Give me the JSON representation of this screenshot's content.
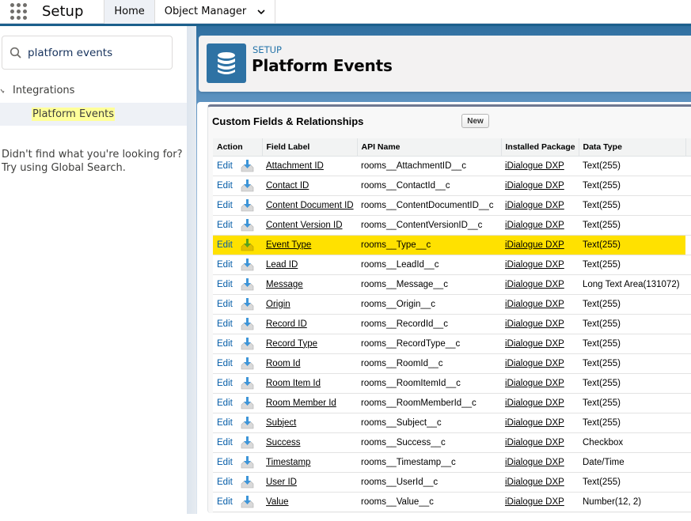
{
  "topbar": {
    "app_launcher_icon": "app-launcher-grid-icon",
    "app_title": "Setup",
    "tabs": [
      {
        "label": "Home",
        "active": true
      },
      {
        "label": "Object Manager",
        "active": false,
        "has_dropdown": true
      }
    ]
  },
  "sidebar": {
    "search": {
      "value": "platform events",
      "icon": "search-icon"
    },
    "tree": {
      "group_label": "Integrations",
      "group_expanded": true,
      "items": [
        {
          "label": "Platform Events",
          "selected": true,
          "highlighted_match": true
        }
      ]
    },
    "help_line1": "Didn't find what you're looking for?",
    "help_line2": "Try using Global Search."
  },
  "header": {
    "icon": "database-icon",
    "eyebrow": "SETUP",
    "title": "Platform Events"
  },
  "related_list": {
    "title": "Custom Fields & Relationships",
    "new_button": "New",
    "columns": [
      "Action",
      "Field Label",
      "API Name",
      "Installed Package",
      "Data Type"
    ],
    "highlight_color": "#ffe100",
    "rows": [
      {
        "action": "Edit",
        "label": "Attachment ID",
        "api": "rooms__AttachmentID__c",
        "package": "iDialogue DXP",
        "type": "Text(255)",
        "highlighted": false
      },
      {
        "action": "Edit",
        "label": "Contact ID",
        "api": "rooms__ContactId__c",
        "package": "iDialogue DXP",
        "type": "Text(255)",
        "highlighted": false
      },
      {
        "action": "Edit",
        "label": "Content Document ID",
        "api": "rooms__ContentDocumentID__c",
        "package": "iDialogue DXP",
        "type": "Text(255)",
        "highlighted": false
      },
      {
        "action": "Edit",
        "label": "Content Version ID",
        "api": "rooms__ContentVersionID__c",
        "package": "iDialogue DXP",
        "type": "Text(255)",
        "highlighted": false
      },
      {
        "action": "Edit",
        "label": "Event Type",
        "api": "rooms__Type__c",
        "package": "iDialogue DXP",
        "type": "Text(255)",
        "highlighted": true
      },
      {
        "action": "Edit",
        "label": "Lead ID",
        "api": "rooms__LeadId__c",
        "package": "iDialogue DXP",
        "type": "Text(255)",
        "highlighted": false
      },
      {
        "action": "Edit",
        "label": "Message",
        "api": "rooms__Message__c",
        "package": "iDialogue DXP",
        "type": "Long Text Area(131072)",
        "highlighted": false
      },
      {
        "action": "Edit",
        "label": "Origin",
        "api": "rooms__Origin__c",
        "package": "iDialogue DXP",
        "type": "Text(255)",
        "highlighted": false
      },
      {
        "action": "Edit",
        "label": "Record ID",
        "api": "rooms__RecordId__c",
        "package": "iDialogue DXP",
        "type": "Text(255)",
        "highlighted": false
      },
      {
        "action": "Edit",
        "label": "Record Type",
        "api": "rooms__RecordType__c",
        "package": "iDialogue DXP",
        "type": "Text(255)",
        "highlighted": false
      },
      {
        "action": "Edit",
        "label": "Room Id",
        "api": "rooms__RoomId__c",
        "package": "iDialogue DXP",
        "type": "Text(255)",
        "highlighted": false
      },
      {
        "action": "Edit",
        "label": "Room Item Id",
        "api": "rooms__RoomItemId__c",
        "package": "iDialogue DXP",
        "type": "Text(255)",
        "highlighted": false
      },
      {
        "action": "Edit",
        "label": "Room Member Id",
        "api": "rooms__RoomMemberId__c",
        "package": "iDialogue DXP",
        "type": "Text(255)",
        "highlighted": false
      },
      {
        "action": "Edit",
        "label": "Subject",
        "api": "rooms__Subject__c",
        "package": "iDialogue DXP",
        "type": "Text(255)",
        "highlighted": false
      },
      {
        "action": "Edit",
        "label": "Success",
        "api": "rooms__Success__c",
        "package": "iDialogue DXP",
        "type": "Checkbox",
        "highlighted": false
      },
      {
        "action": "Edit",
        "label": "Timestamp",
        "api": "rooms__Timestamp__c",
        "package": "iDialogue DXP",
        "type": "Date/Time",
        "highlighted": false
      },
      {
        "action": "Edit",
        "label": "User ID",
        "api": "rooms__UserId__c",
        "package": "iDialogue DXP",
        "type": "Text(255)",
        "highlighted": false
      },
      {
        "action": "Edit",
        "label": "Value",
        "api": "rooms__Value__c",
        "package": "iDialogue DXP",
        "type": "Number(12, 2)",
        "highlighted": false
      }
    ]
  }
}
